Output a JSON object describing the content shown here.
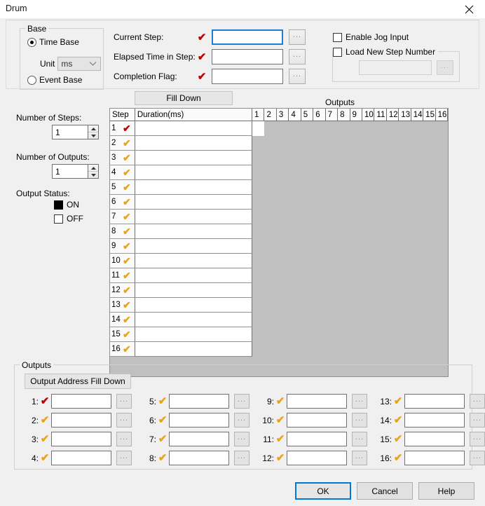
{
  "window": {
    "title": "Drum",
    "close_icon": "close-icon"
  },
  "base_group": {
    "title": "Base",
    "time_base_label": "Time Base",
    "time_base_selected": true,
    "unit_label": "Unit",
    "unit_value": "ms",
    "unit_options": [
      "ms"
    ],
    "event_base_label": "Event Base",
    "event_base_selected": false
  },
  "top_fields": [
    {
      "label": "Current Step:",
      "value": "",
      "mark": "red",
      "focused": true,
      "browse_label": "..."
    },
    {
      "label": "Elapsed Time in Step:",
      "value": "",
      "mark": "red",
      "focused": false,
      "browse_label": "..."
    },
    {
      "label": "Completion Flag:",
      "value": "",
      "mark": "red",
      "focused": false,
      "browse_label": "..."
    }
  ],
  "jog": {
    "enable_jog_label": "Enable Jog Input",
    "enable_jog_checked": false
  },
  "load_step": {
    "title": "Load New Step Number",
    "checked": false,
    "value": "",
    "browse_label": "..."
  },
  "left_panel": {
    "number_of_steps_label": "Number of Steps:",
    "number_of_steps_value": "1",
    "number_of_outputs_label": "Number of Outputs:",
    "number_of_outputs_value": "1",
    "output_status_label": "Output Status:",
    "on_label": "ON",
    "on_checked": true,
    "off_label": "OFF",
    "off_checked": false
  },
  "grid": {
    "fill_down_label": "Fill Down",
    "outputs_header_label": "Outputs",
    "col_step": "Step",
    "col_duration": "Duration(ms)",
    "output_columns": [
      "1",
      "2",
      "3",
      "4",
      "5",
      "6",
      "7",
      "8",
      "9",
      "10",
      "11",
      "12",
      "13",
      "14",
      "15",
      "16"
    ],
    "rows": [
      {
        "step": "1",
        "mark": "red",
        "duration": "",
        "active_output": 1
      },
      {
        "step": "2",
        "mark": "orange",
        "duration": "",
        "active_output": 0
      },
      {
        "step": "3",
        "mark": "orange",
        "duration": "",
        "active_output": 0
      },
      {
        "step": "4",
        "mark": "orange",
        "duration": "",
        "active_output": 0
      },
      {
        "step": "5",
        "mark": "orange",
        "duration": "",
        "active_output": 0
      },
      {
        "step": "6",
        "mark": "orange",
        "duration": "",
        "active_output": 0
      },
      {
        "step": "7",
        "mark": "orange",
        "duration": "",
        "active_output": 0
      },
      {
        "step": "8",
        "mark": "orange",
        "duration": "",
        "active_output": 0
      },
      {
        "step": "9",
        "mark": "orange",
        "duration": "",
        "active_output": 0
      },
      {
        "step": "10",
        "mark": "orange",
        "duration": "",
        "active_output": 0
      },
      {
        "step": "11",
        "mark": "orange",
        "duration": "",
        "active_output": 0
      },
      {
        "step": "12",
        "mark": "orange",
        "duration": "",
        "active_output": 0
      },
      {
        "step": "13",
        "mark": "orange",
        "duration": "",
        "active_output": 0
      },
      {
        "step": "14",
        "mark": "orange",
        "duration": "",
        "active_output": 0
      },
      {
        "step": "15",
        "mark": "orange",
        "duration": "",
        "active_output": 0
      },
      {
        "step": "16",
        "mark": "orange",
        "duration": "",
        "active_output": 0
      }
    ]
  },
  "outputs_group": {
    "title": "Outputs",
    "fill_down_label": "Output Address Fill Down",
    "browse_label": "...",
    "entries": [
      {
        "index": "1:",
        "mark": "red",
        "value": ""
      },
      {
        "index": "2:",
        "mark": "orange",
        "value": ""
      },
      {
        "index": "3:",
        "mark": "orange",
        "value": ""
      },
      {
        "index": "4:",
        "mark": "orange",
        "value": ""
      },
      {
        "index": "5:",
        "mark": "orange",
        "value": ""
      },
      {
        "index": "6:",
        "mark": "orange",
        "value": ""
      },
      {
        "index": "7:",
        "mark": "orange",
        "value": ""
      },
      {
        "index": "8:",
        "mark": "orange",
        "value": ""
      },
      {
        "index": "9:",
        "mark": "orange",
        "value": ""
      },
      {
        "index": "10:",
        "mark": "orange",
        "value": ""
      },
      {
        "index": "11:",
        "mark": "orange",
        "value": ""
      },
      {
        "index": "12:",
        "mark": "orange",
        "value": ""
      },
      {
        "index": "13:",
        "mark": "orange",
        "value": ""
      },
      {
        "index": "14:",
        "mark": "orange",
        "value": ""
      },
      {
        "index": "15:",
        "mark": "orange",
        "value": ""
      },
      {
        "index": "16:",
        "mark": "orange",
        "value": ""
      }
    ]
  },
  "footer": {
    "ok_label": "OK",
    "cancel_label": "Cancel",
    "help_label": "Help"
  },
  "colors": {
    "mark_red": "#c00000",
    "mark_orange": "#e8a317",
    "focus_blue": "#1d7fd4",
    "grid_gray": "#c0c0c0",
    "dialog_bg": "#f0f0f0"
  }
}
